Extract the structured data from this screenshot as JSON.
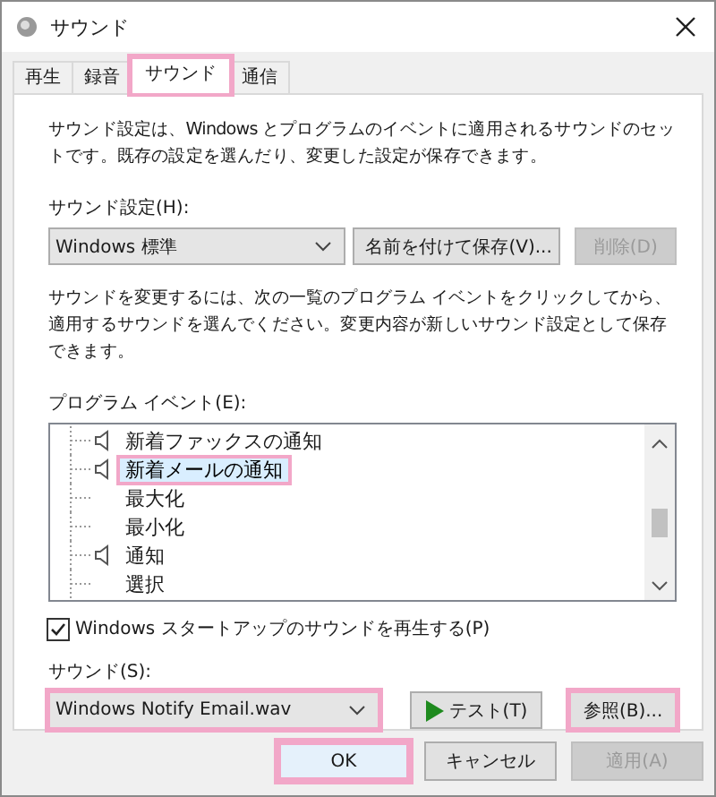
{
  "window": {
    "title": "サウンド"
  },
  "tabs": [
    {
      "label": "再生",
      "selected": false,
      "highlighted": false
    },
    {
      "label": "録音",
      "selected": false,
      "highlighted": false
    },
    {
      "label": "サウンド",
      "selected": true,
      "highlighted": true
    },
    {
      "label": "通信",
      "selected": false,
      "highlighted": false
    }
  ],
  "description": "サウンド設定は、Windows とプログラムのイベントに適用されるサウンドのセットです。既存の設定を選んだり、変更した設定が保存できます。",
  "scheme": {
    "label": "サウンド設定(H):",
    "value": "Windows 標準"
  },
  "scheme_buttons": [
    {
      "label": "名前を付けて保存(V)...",
      "disabled": false
    },
    {
      "label": "削除(D)",
      "disabled": true
    }
  ],
  "instructions": "サウンドを変更するには、次の一覧のプログラム イベントをクリックしてから、適用するサウンドを選んでください。変更内容が新しいサウンド設定として保存できます。",
  "events": {
    "label": "プログラム イベント(E):",
    "items": [
      {
        "name": "新着ファックスの通知",
        "has_sound": true,
        "selected": false,
        "highlighted": false
      },
      {
        "name": "新着メールの通知",
        "has_sound": true,
        "selected": true,
        "highlighted": true
      },
      {
        "name": "最大化",
        "has_sound": false,
        "selected": false,
        "highlighted": false
      },
      {
        "name": "最小化",
        "has_sound": false,
        "selected": false,
        "highlighted": false
      },
      {
        "name": "通知",
        "has_sound": true,
        "selected": false,
        "highlighted": false
      },
      {
        "name": "選択",
        "has_sound": false,
        "selected": false,
        "highlighted": false
      }
    ]
  },
  "startup_sound": {
    "label": "Windows スタートアップのサウンドを再生する(P)",
    "checked": true
  },
  "sound": {
    "label": "サウンド(S):",
    "value": "Windows Notify Email.wav",
    "highlighted": true
  },
  "test_button": {
    "label": "テスト(T)",
    "highlighted": false
  },
  "browse_button": {
    "label": "参照(B)...",
    "highlighted": true
  },
  "dialog_buttons": [
    {
      "label": "OK",
      "disabled": false,
      "default": true,
      "highlighted": true
    },
    {
      "label": "キャンセル",
      "disabled": false,
      "default": false,
      "highlighted": false
    },
    {
      "label": "適用(A)",
      "disabled": true,
      "default": false,
      "highlighted": false
    }
  ]
}
